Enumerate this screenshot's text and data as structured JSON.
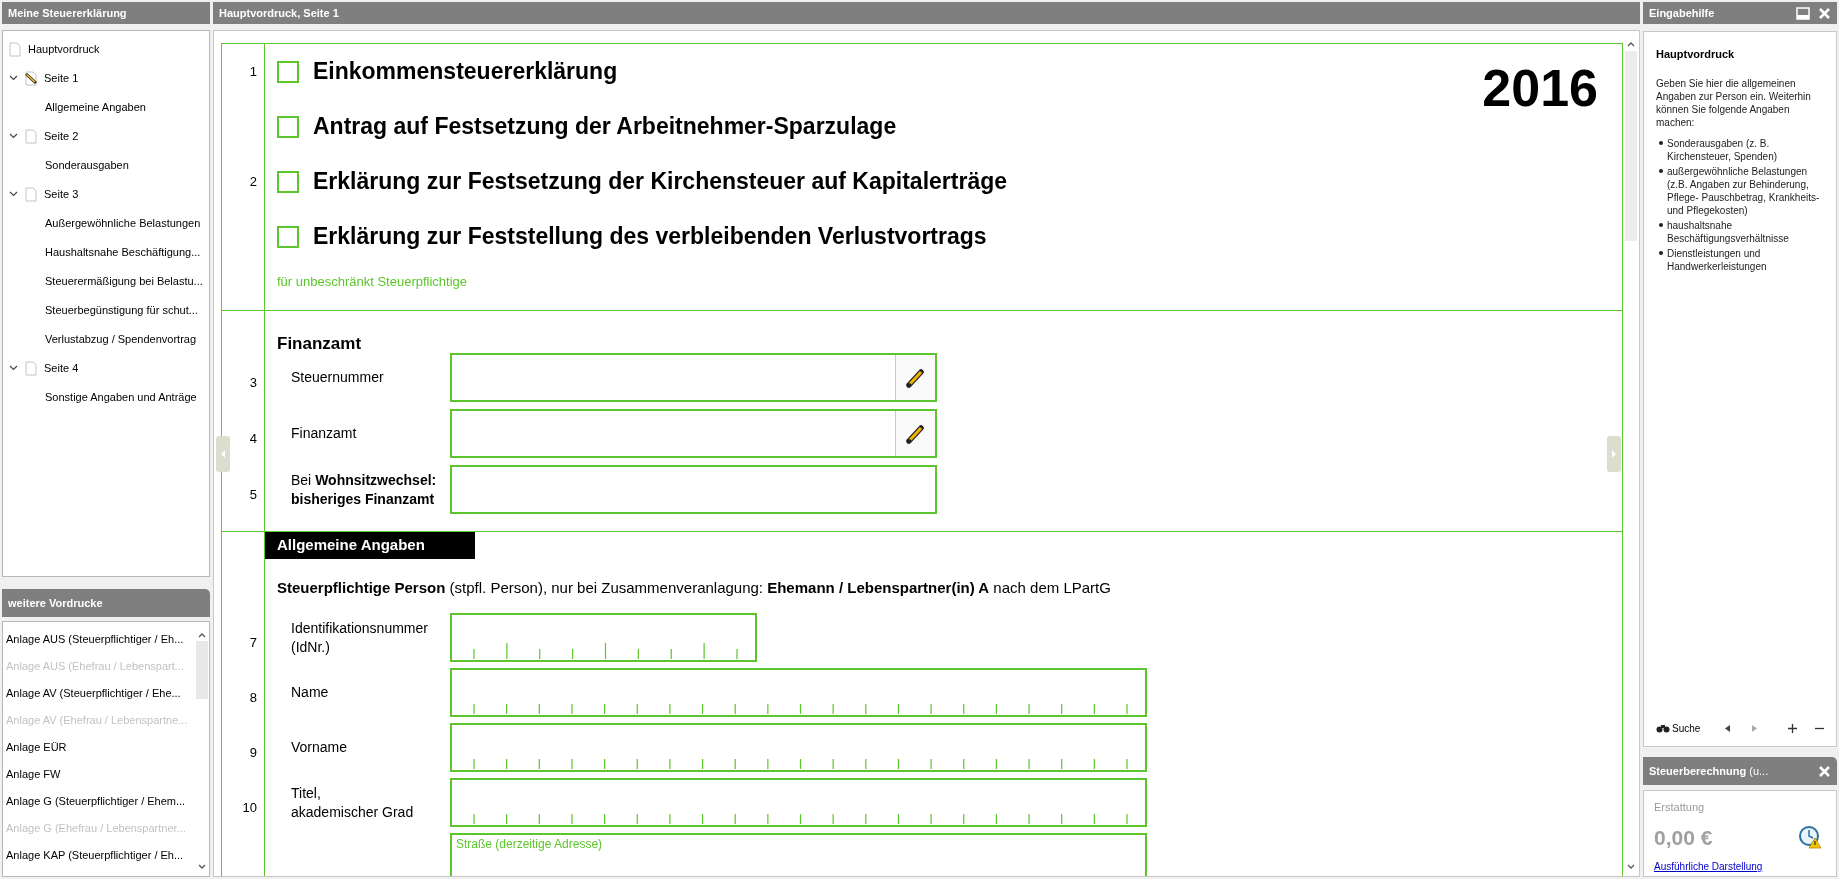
{
  "sidebar": {
    "title": "Meine Steuererklärung",
    "tree": [
      {
        "label": "Hauptvordruck",
        "kind": "page"
      },
      {
        "label": "Seite 1",
        "kind": "edited",
        "expanded": true,
        "children": [
          {
            "label": "Allgemeine Angaben"
          }
        ]
      },
      {
        "label": "Seite 2",
        "kind": "page",
        "expanded": true,
        "children": [
          {
            "label": "Sonderausgaben"
          }
        ]
      },
      {
        "label": "Seite 3",
        "kind": "page",
        "expanded": true,
        "children": [
          {
            "label": "Außergewöhnliche Belastungen"
          },
          {
            "label": "Haushaltsnahe Beschäftigung..."
          },
          {
            "label": "Steuerermäßigung bei Belastu..."
          },
          {
            "label": "Steuerbegünstigung für schut..."
          },
          {
            "label": "Verlustabzug / Spendenvortrag"
          }
        ]
      },
      {
        "label": "Seite 4",
        "kind": "page",
        "expanded": true,
        "children": [
          {
            "label": "Sonstige Angaben und Anträge"
          }
        ]
      }
    ]
  },
  "more_forms": {
    "title": "weitere Vordrucke",
    "items": [
      {
        "label": "Anlage AUS (Steuerpflichtiger / Eh...",
        "disabled": false
      },
      {
        "label": "Anlage AUS (Ehefrau / Lebenspart...",
        "disabled": true
      },
      {
        "label": "Anlage AV (Steuerpflichtiger / Ehe...",
        "disabled": false
      },
      {
        "label": "Anlage AV (Ehefrau / Lebenspartne...",
        "disabled": true
      },
      {
        "label": "Anlage EÜR",
        "disabled": false
      },
      {
        "label": "Anlage FW",
        "disabled": false
      },
      {
        "label": "Anlage G (Steuerpflichtiger / Ehem...",
        "disabled": false
      },
      {
        "label": "Anlage G (Ehefrau / Lebenspartner...",
        "disabled": true
      },
      {
        "label": "Anlage KAP (Steuerpflichtiger / Eh...",
        "disabled": false
      }
    ]
  },
  "document": {
    "title": "Hauptvordruck, Seite 1",
    "sections": [
      {
        "kind": "declarations",
        "year": "2016",
        "note": "für unbeschränkt Steuerpflichtige",
        "items": [
          {
            "line": "1",
            "label": "Einkommensteuererklärung",
            "checked": false
          },
          {
            "label": "Antrag auf Festsetzung der Arbeitnehmer-Sparzulage",
            "checked": false
          },
          {
            "line": "2",
            "label": "Erklärung zur Festsetzung der Kirchensteuer auf Kapitalerträge",
            "checked": false
          },
          {
            "label": "Erklärung zur Feststellung des verbleibenden Verlustvortrags",
            "checked": false
          }
        ]
      },
      {
        "kind": "fields",
        "title": "Finanzamt",
        "rows": [
          {
            "line": "3",
            "label": "Steuernummer",
            "kind": "lookup"
          },
          {
            "line": "4",
            "label": "Finanzamt",
            "kind": "lookup"
          },
          {
            "line": "5",
            "label": "Bei **Wohnsitzwechsel:**\n**bisheriges Finanzamt**",
            "kind": "text"
          }
        ]
      },
      {
        "kind": "fields",
        "heading": "Allgemeine Angaben",
        "intro": "**Steuerpflichtige Person** (stpfl. Person), nur bei Zusammenveranlagung: **Ehemann / Lebenspartner(in) A** nach dem LPartG",
        "rows": [
          {
            "line": "7",
            "label": "Identifikationsnummer\n(IdNr.)",
            "kind": "comb_short"
          },
          {
            "line": "8",
            "label": "Name",
            "kind": "comb"
          },
          {
            "line": "9",
            "label": "Vorname",
            "kind": "comb"
          },
          {
            "line": "10",
            "label": "Titel,\nakademischer Grad",
            "kind": "comb"
          },
          {
            "kind": "address",
            "placeholder": "Straße (derzeitige Adresse)"
          }
        ]
      }
    ]
  },
  "help": {
    "title": "Eingabehilfe",
    "heading": "Hauptvordruck",
    "text": "Geben Sie hier die allgemeinen Angaben zur Person ein. Weiterhin können Sie folgende Angaben machen:",
    "bullets": [
      "Sonderausgaben (z. B. Kirchensteuer, Spenden)",
      "außergewöhnliche Belastungen (z.B. Angaben zur Behinderung, Pflege- Pauschbetrag, Krankheits- und Pflegekosten)",
      "haushaltsnahe Beschäftigungsverhältnisse",
      "Dienstleistungen und Handwerkerleistungen"
    ],
    "search_label": "Suche"
  },
  "tax_calc": {
    "title": "**Steuerberechnung** (u...",
    "label": "Erstattung",
    "amount": "0,00 €",
    "link": "Ausführliche Darstellung"
  }
}
